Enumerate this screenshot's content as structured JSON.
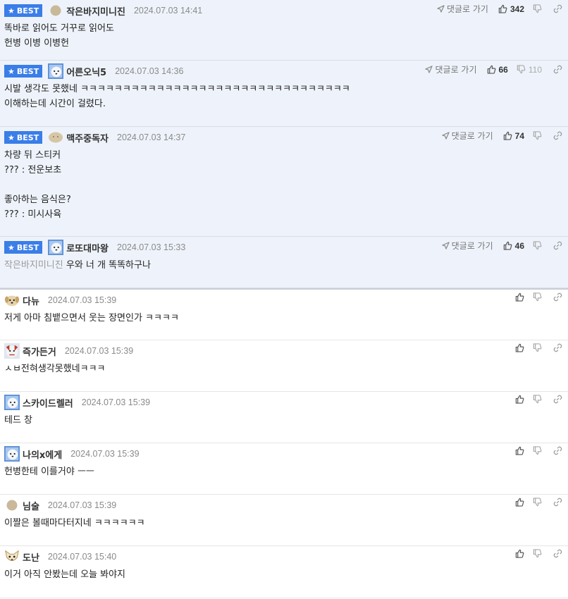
{
  "best_label": "BEST",
  "reply_label": "댓글로 가기",
  "comments": [
    {
      "best": true,
      "nick": "작은바지미니진",
      "date": "2024.07.03 14:41",
      "likes": "342",
      "dislikes": "",
      "avatar": "beige-circle",
      "text": "똑바로 읽어도 거꾸로 읽어도\n헌병 이병 이병헌",
      "mention": ""
    },
    {
      "best": true,
      "nick": "어른오닉5",
      "date": "2024.07.03 14:36",
      "likes": "66",
      "dislikes": "110",
      "avatar": "white-dog",
      "text": "시발 생각도 못했네 ㅋㅋㅋㅋㅋㅋㅋㅋㅋㅋㅋㅋㅋㅋㅋㅋㅋㅋㅋㅋㅋㅋㅋㅋㅋㅋㅋㅋㅋㅋㅋㅋ\n이해하는데 시간이 걸렸다.",
      "mention": ""
    },
    {
      "best": true,
      "nick": "맥주중독자",
      "date": "2024.07.03 14:37",
      "likes": "74",
      "dislikes": "",
      "avatar": "beige-blob",
      "text": "차량 뒤 스티커\n??? : 전운보초\n\n좋아하는 음식은?\n??? : 미시사육",
      "mention": ""
    },
    {
      "best": true,
      "nick": "로또대마왕",
      "date": "2024.07.03 15:33",
      "likes": "46",
      "dislikes": "",
      "avatar": "white-dog",
      "text": "우와 너 개 똑똑하구나",
      "mention": "작은바지미니진"
    },
    {
      "best": false,
      "nick": "다뉴",
      "date": "2024.07.03 15:39",
      "likes": "",
      "dislikes": "",
      "avatar": "puppy",
      "text": "저게 아마 침뱉으면서 웃는 장면인가 ㅋㅋㅋㅋ",
      "mention": ""
    },
    {
      "best": false,
      "nick": "즉가든거",
      "date": "2024.07.03 15:39",
      "likes": "",
      "dislikes": "",
      "avatar": "red-dog",
      "text": "ㅅㅂ전혀생각못했네ㅋㅋㅋ",
      "mention": ""
    },
    {
      "best": false,
      "nick": "스카이드렐러",
      "date": "2024.07.03 15:39",
      "likes": "",
      "dislikes": "",
      "avatar": "white-dog",
      "text": "테드 창",
      "mention": ""
    },
    {
      "best": false,
      "nick": "나의x에게",
      "date": "2024.07.03 15:39",
      "likes": "",
      "dislikes": "",
      "avatar": "white-dog",
      "text": "헌병한테 이를거야 ㅡㅡ",
      "mention": ""
    },
    {
      "best": false,
      "nick": "님술",
      "date": "2024.07.03 15:39",
      "likes": "",
      "dislikes": "",
      "avatar": "beige-circle",
      "text": "이짤은 볼때마다터지네 ㅋㅋㅋㅋㅋㅋ",
      "mention": ""
    },
    {
      "best": false,
      "nick": "도난",
      "date": "2024.07.03 15:40",
      "likes": "",
      "dislikes": "",
      "avatar": "fox-dog",
      "text": "이거 아직 안봤는데 오늘 봐야지",
      "mention": ""
    }
  ]
}
